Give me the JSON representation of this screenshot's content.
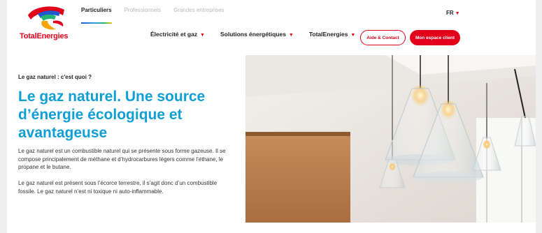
{
  "brand": {
    "name": "TotalEnergies",
    "colors": {
      "red": "#e2001a",
      "blue": "#0f9ed5"
    }
  },
  "header": {
    "segments": [
      "Particuliers",
      "Professionnels",
      "Grandes entreprises"
    ],
    "active_segment": "Particuliers",
    "language": "FR",
    "nav": [
      "Électricité et gaz",
      "Solutions énergétiques",
      "TotalEnergies"
    ],
    "contact_button": "Aide & Contact",
    "account_button": "Mon espace client"
  },
  "content": {
    "breadcrumb": "Le gaz naturel : c'est quoi ?",
    "headline": "Le gaz naturel. Une source d’énergie écologique et avantageuse",
    "paragraphs": [
      "Le gaz naturel est un combustible naturel qui se présente sous forme gazeuse. Il se compose principalement de méthane et d’hydrocarbures légers comme l’éthane, le propane et le butane.",
      "Le gaz naturel est présent sous l’écorce terrestre, il s’agit donc d’un combustible fossile. Le gaz naturel n’est ni toxique ni auto-inflammable."
    ]
  },
  "icons": {
    "dropdown": "chevron-down-icon",
    "logo": "totalenergies-logo"
  }
}
